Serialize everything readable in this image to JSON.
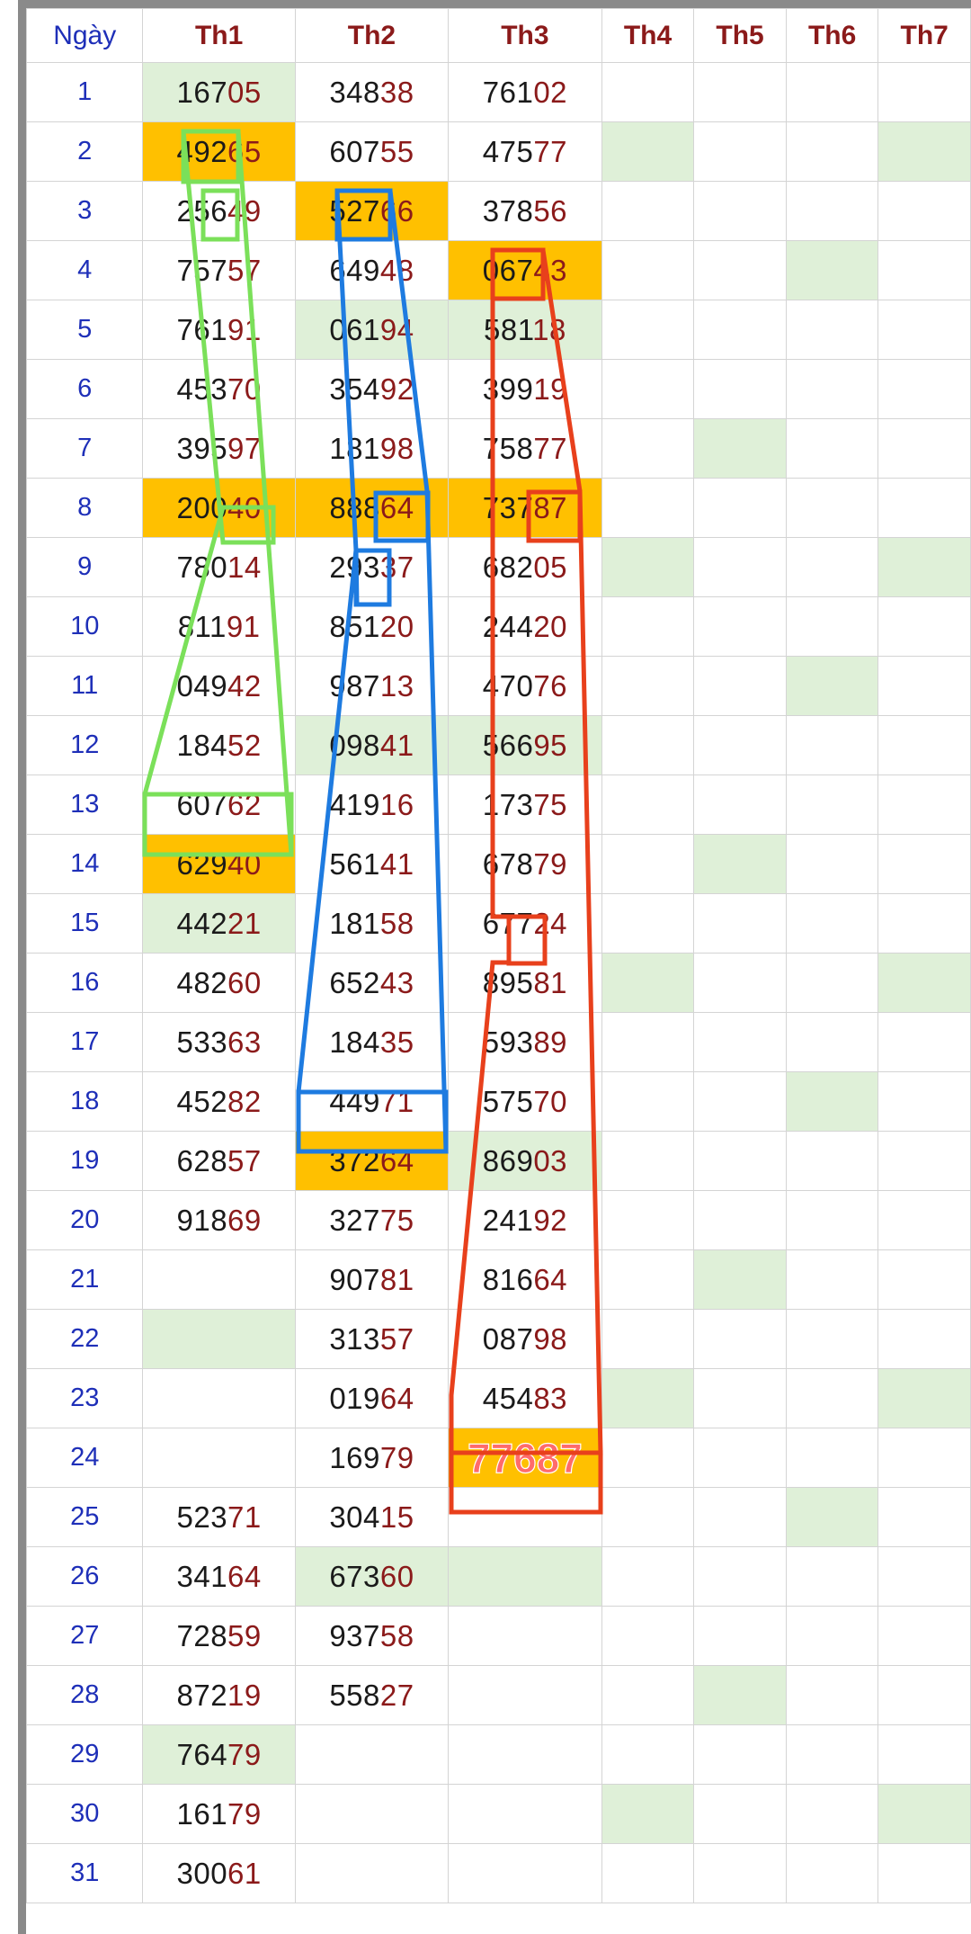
{
  "headers": [
    "Ngày",
    "Th1",
    "Th2",
    "Th3",
    "Th4",
    "Th5",
    "Th6",
    "Th7"
  ],
  "rows": [
    {
      "day": "1",
      "cells": [
        "16705",
        "34838",
        "76102",
        "",
        "",
        "",
        ""
      ],
      "shade": [
        "g",
        "",
        "",
        "",
        "",
        "",
        ""
      ]
    },
    {
      "day": "2",
      "cells": [
        "49265",
        "60755",
        "47577",
        "",
        "",
        "",
        ""
      ],
      "shade": [
        "o",
        "",
        "",
        "g",
        "",
        "",
        "g"
      ]
    },
    {
      "day": "3",
      "cells": [
        "25649",
        "52766",
        "37856",
        "",
        "",
        "",
        ""
      ],
      "shade": [
        "",
        "o",
        "",
        "",
        "",
        "",
        ""
      ]
    },
    {
      "day": "4",
      "cells": [
        "75757",
        "64948",
        "06743",
        "",
        "",
        "",
        ""
      ],
      "shade": [
        "",
        "",
        "o",
        "",
        "",
        "g",
        ""
      ]
    },
    {
      "day": "5",
      "cells": [
        "76191",
        "06194",
        "58118",
        "",
        "",
        "",
        ""
      ],
      "shade": [
        "",
        "g",
        "g",
        "",
        "",
        "",
        ""
      ]
    },
    {
      "day": "6",
      "cells": [
        "45370",
        "35492",
        "39919",
        "",
        "",
        "",
        ""
      ],
      "shade": [
        "",
        "",
        "",
        "",
        "",
        "",
        ""
      ]
    },
    {
      "day": "7",
      "cells": [
        "39597",
        "18198",
        "75877",
        "",
        "",
        "",
        ""
      ],
      "shade": [
        "",
        "",
        "",
        "",
        "g",
        "",
        ""
      ]
    },
    {
      "day": "8",
      "cells": [
        "20040",
        "88864",
        "73787",
        "",
        "",
        "",
        ""
      ],
      "shade": [
        "o",
        "o",
        "o",
        "",
        "",
        "",
        ""
      ]
    },
    {
      "day": "9",
      "cells": [
        "78014",
        "29337",
        "68205",
        "",
        "",
        "",
        ""
      ],
      "shade": [
        "",
        "",
        "",
        "g",
        "",
        "",
        "g"
      ]
    },
    {
      "day": "10",
      "cells": [
        "81191",
        "85120",
        "24420",
        "",
        "",
        "",
        ""
      ],
      "shade": [
        "",
        "",
        "",
        "",
        "",
        "",
        ""
      ]
    },
    {
      "day": "11",
      "cells": [
        "04942",
        "98713",
        "47076",
        "",
        "",
        "",
        ""
      ],
      "shade": [
        "",
        "",
        "",
        "",
        "",
        "g",
        ""
      ]
    },
    {
      "day": "12",
      "cells": [
        "18452",
        "09841",
        "56695",
        "",
        "",
        "",
        ""
      ],
      "shade": [
        "",
        "g",
        "g",
        "",
        "",
        "",
        ""
      ]
    },
    {
      "day": "13",
      "cells": [
        "60762",
        "41916",
        "17375",
        "",
        "",
        "",
        ""
      ],
      "shade": [
        "",
        "",
        "",
        "",
        "",
        "",
        ""
      ]
    },
    {
      "day": "14",
      "cells": [
        "62940",
        "56141",
        "67879",
        "",
        "",
        "",
        ""
      ],
      "shade": [
        "o",
        "",
        "",
        "",
        "g",
        "",
        ""
      ]
    },
    {
      "day": "15",
      "cells": [
        "44221",
        "18158",
        "67724",
        "",
        "",
        "",
        ""
      ],
      "shade": [
        "g",
        "",
        "",
        "",
        "",
        "",
        ""
      ]
    },
    {
      "day": "16",
      "cells": [
        "48260",
        "65243",
        "89581",
        "",
        "",
        "",
        ""
      ],
      "shade": [
        "",
        "",
        "",
        "g",
        "",
        "",
        "g"
      ]
    },
    {
      "day": "17",
      "cells": [
        "53363",
        "18435",
        "59389",
        "",
        "",
        "",
        ""
      ],
      "shade": [
        "",
        "",
        "",
        "",
        "",
        "",
        ""
      ]
    },
    {
      "day": "18",
      "cells": [
        "45282",
        "44971",
        "57570",
        "",
        "",
        "",
        ""
      ],
      "shade": [
        "",
        "",
        "",
        "",
        "",
        "g",
        ""
      ]
    },
    {
      "day": "19",
      "cells": [
        "62857",
        "37264",
        "86903",
        "",
        "",
        "",
        ""
      ],
      "shade": [
        "",
        "o",
        "g",
        "",
        "",
        "",
        ""
      ]
    },
    {
      "day": "20",
      "cells": [
        "91869",
        "32775",
        "24192",
        "",
        "",
        "",
        ""
      ],
      "shade": [
        "",
        "",
        "",
        "",
        "",
        "",
        ""
      ]
    },
    {
      "day": "21",
      "cells": [
        "",
        "90781",
        "81664",
        "",
        "",
        "",
        ""
      ],
      "shade": [
        "",
        "",
        "",
        "",
        "g",
        "",
        ""
      ]
    },
    {
      "day": "22",
      "cells": [
        "",
        "31357",
        "08798",
        "",
        "",
        "",
        ""
      ],
      "shade": [
        "g",
        "",
        "",
        "",
        "",
        "",
        ""
      ]
    },
    {
      "day": "23",
      "cells": [
        "",
        "01964",
        "45483",
        "",
        "",
        "",
        ""
      ],
      "shade": [
        "",
        "",
        "",
        "g",
        "",
        "",
        "g"
      ]
    },
    {
      "day": "24",
      "cells": [
        "",
        "16979",
        "77687",
        "",
        "",
        "",
        ""
      ],
      "shade": [
        "",
        "",
        "big",
        "",
        "",
        "",
        ""
      ]
    },
    {
      "day": "25",
      "cells": [
        "52371",
        "30415",
        "",
        "",
        "",
        "",
        ""
      ],
      "shade": [
        "",
        "",
        "",
        "",
        "",
        "g",
        ""
      ]
    },
    {
      "day": "26",
      "cells": [
        "34164",
        "67360",
        "",
        "",
        "",
        "",
        ""
      ],
      "shade": [
        "",
        "g",
        "g",
        "",
        "",
        "",
        ""
      ]
    },
    {
      "day": "27",
      "cells": [
        "72859",
        "93758",
        "",
        "",
        "",
        "",
        ""
      ],
      "shade": [
        "",
        "",
        "",
        "",
        "",
        "",
        ""
      ]
    },
    {
      "day": "28",
      "cells": [
        "87219",
        "55827",
        "",
        "",
        "",
        "",
        ""
      ],
      "shade": [
        "",
        "",
        "",
        "",
        "g",
        "",
        ""
      ]
    },
    {
      "day": "29",
      "cells": [
        "76479",
        "",
        "",
        "",
        "",
        "",
        ""
      ],
      "shade": [
        "g",
        "",
        "",
        "",
        "",
        "",
        ""
      ]
    },
    {
      "day": "30",
      "cells": [
        "16179",
        "",
        "",
        "",
        "",
        "",
        ""
      ],
      "shade": [
        "",
        "",
        "",
        "g",
        "",
        "",
        "g"
      ]
    },
    {
      "day": "31",
      "cells": [
        "30061",
        "",
        "",
        "",
        "",
        "",
        ""
      ],
      "shade": [
        "",
        "",
        "",
        "",
        "",
        "",
        ""
      ]
    }
  ],
  "colors": {
    "header_text": "#8b1a1a",
    "day_text": "#1e2fb8",
    "digit_tail": "#8b1a1a",
    "highlight_orange": "#ffc000",
    "highlight_green": "#dff0d8",
    "marker_green": "#7be05a",
    "marker_blue": "#1e7be0",
    "marker_red": "#e8401c"
  }
}
